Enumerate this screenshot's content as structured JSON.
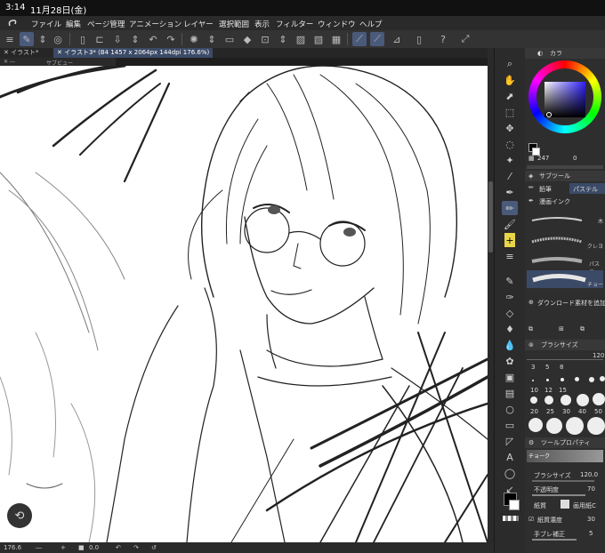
{
  "status": {
    "time": "3:14",
    "date": "11月28日(金)"
  },
  "menu": [
    "ファイル",
    "編集",
    "ページ管理",
    "アニメーション",
    "レイヤー",
    "選択範囲",
    "表示",
    "フィルター",
    "ウィンドウ",
    "ヘルプ"
  ],
  "tabs": [
    {
      "label": "イラスト*",
      "active": false
    },
    {
      "label": "イラスト3* (B4 1457 x 2064px 144dpi 176.6%)",
      "active": true
    }
  ],
  "subview_label": "サブビュー",
  "bottom": {
    "zoom": "176.6",
    "angle": "0.0"
  },
  "panel": {
    "color_tab": "カラ",
    "color_value": "247",
    "color_zero": "0",
    "subtool_header": "サブツール",
    "subtool_tabs": [
      "鉛筆",
      "パステル"
    ],
    "subtool_group": "漫画インク",
    "brushes": [
      "木",
      "クレヨ",
      "パステ",
      "チョー"
    ],
    "download_label": "ダウンロード素材を追加す",
    "brush_size_header": "ブラシサイズ",
    "brush_size_value": "120.",
    "size_labels_row1": [
      "3",
      "5",
      "8",
      "10",
      "12",
      "15"
    ],
    "size_labels_row2": [
      "20",
      "25",
      "30",
      "40",
      "50"
    ],
    "tool_prop_header": "ツールプロパティ",
    "tool_prop_brush": "チョーク",
    "props": [
      {
        "label": "ブラシサイズ",
        "value": "120.0"
      },
      {
        "label": "不透明度",
        "value": "70"
      },
      {
        "label": "紙質",
        "value": "画用紙C"
      },
      {
        "label": "紙質濃度",
        "value": "30"
      },
      {
        "label": "手ブレ補正",
        "value": "5"
      }
    ]
  },
  "colors": {
    "accent": "#4a5a7a",
    "main": "#000000",
    "sub": "#ffffff"
  }
}
